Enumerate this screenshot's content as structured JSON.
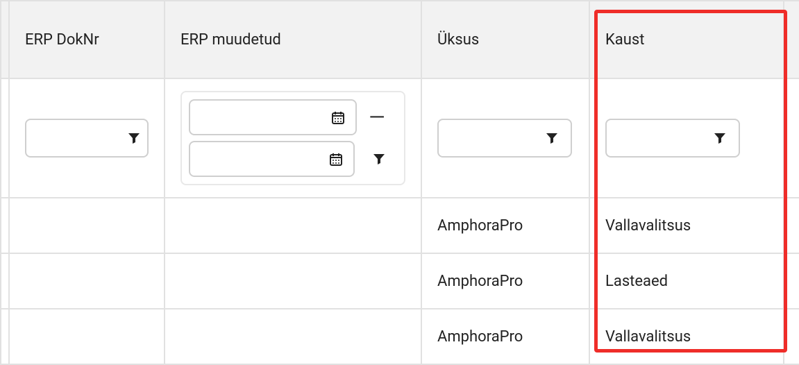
{
  "columns": {
    "erp_doknr": "ERP DokNr",
    "erp_muudetud": "ERP muudetud",
    "yksus": "Üksus",
    "kaust": "Kaust"
  },
  "filters": {
    "erp_doknr": "",
    "erp_muudetud_from": "",
    "erp_muudetud_to": "",
    "yksus": "",
    "kaust": ""
  },
  "rows": [
    {
      "erp_doknr": "",
      "erp_muudetud": "",
      "yksus": "AmphoraPro",
      "kaust": "Vallavalitsus"
    },
    {
      "erp_doknr": "",
      "erp_muudetud": "",
      "yksus": "AmphoraPro",
      "kaust": "Lasteaed"
    },
    {
      "erp_doknr": "",
      "erp_muudetud": "",
      "yksus": "AmphoraPro",
      "kaust": "Vallavalitsus"
    }
  ]
}
